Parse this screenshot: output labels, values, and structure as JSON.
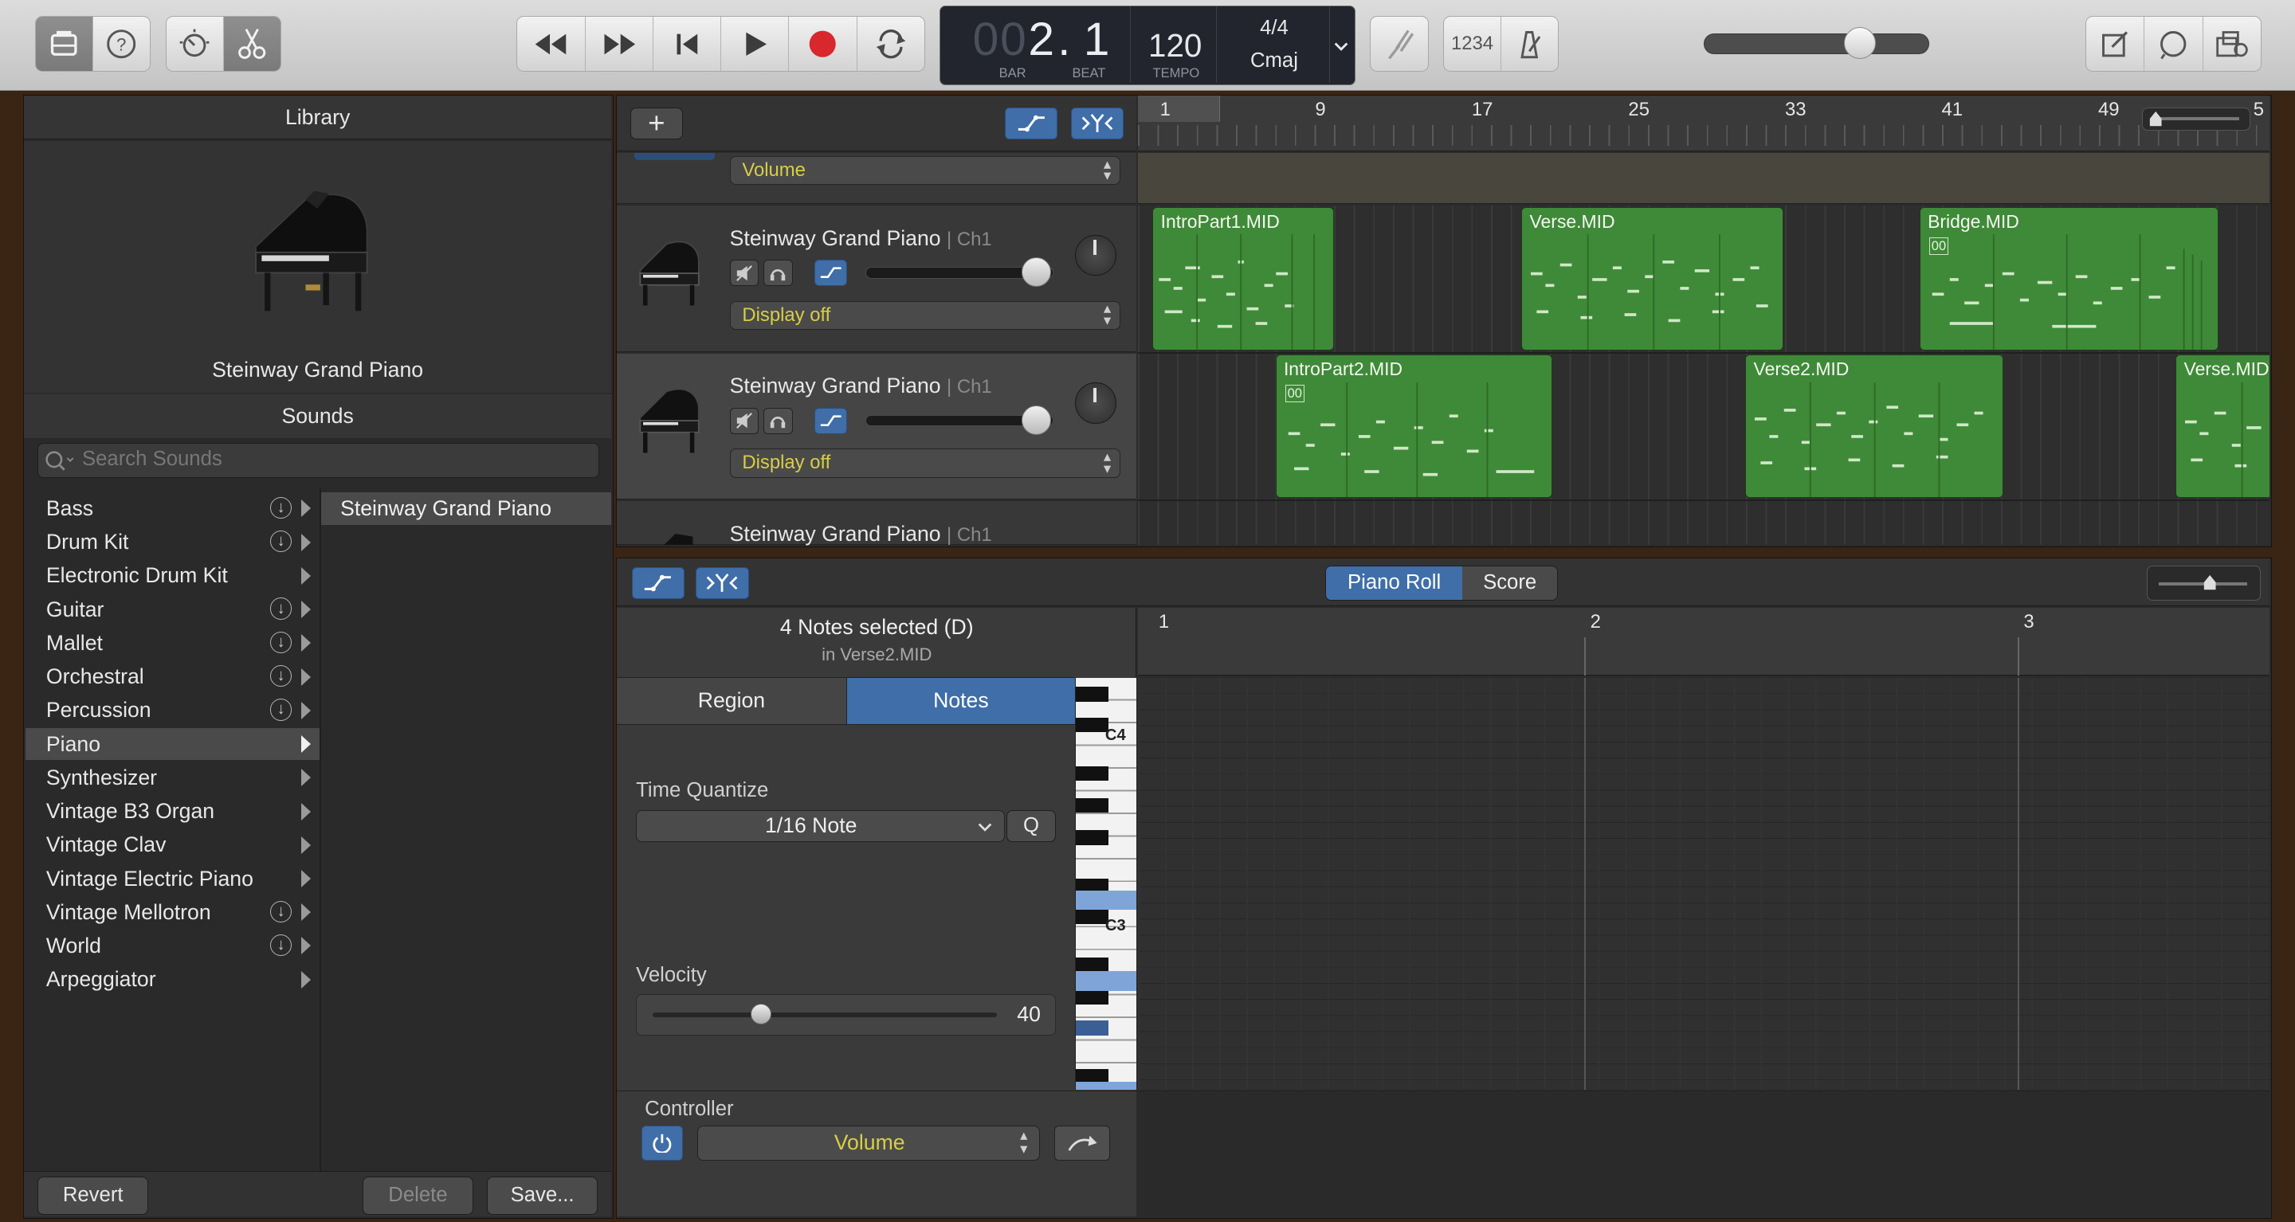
{
  "toolbar": {
    "lcd": {
      "bar_dim": "00",
      "bar": "2",
      "beat": ". 1",
      "bar_label": "BAR",
      "beat_label": "BEAT",
      "tempo": "120",
      "tempo_label": "TEMPO",
      "signature": "4/4",
      "key": "Cmaj"
    },
    "count_in_label": "1234",
    "master_volume": 0.69
  },
  "library": {
    "title": "Library",
    "patch_name": "Steinway Grand Piano",
    "sounds_header": "Sounds",
    "search_placeholder": "Search Sounds",
    "categories": [
      {
        "label": "Bass"
      },
      {
        "label": "Drum Kit"
      },
      {
        "label": "Electronic Drum Kit"
      },
      {
        "label": "Guitar"
      },
      {
        "label": "Mallet"
      },
      {
        "label": "Orchestral"
      },
      {
        "label": "Percussion"
      },
      {
        "label": "Piano"
      },
      {
        "label": "Synthesizer"
      },
      {
        "label": "Vintage B3 Organ"
      },
      {
        "label": "Vintage Clav"
      },
      {
        "label": "Vintage Electric Piano"
      },
      {
        "label": "Vintage Mellotron"
      },
      {
        "label": "World"
      },
      {
        "label": "Arpeggiator"
      }
    ],
    "selected_category": "Piano",
    "sub_items": [
      "Steinway Grand Piano"
    ],
    "revert_label": "Revert",
    "delete_label": "Delete",
    "save_label": "Save..."
  },
  "tracks": {
    "add_label": "+",
    "ruler": [
      "1",
      "9",
      "17",
      "25",
      "33",
      "41",
      "49",
      "5"
    ],
    "automation_param": "Volume",
    "rows": [
      {
        "name": "Steinway Grand Piano",
        "channel": "| Ch1",
        "display": "Display off"
      },
      {
        "name": "Steinway Grand Piano",
        "channel": "| Ch1",
        "display": "Display off"
      },
      {
        "name": "Steinway Grand Piano",
        "channel": "| Ch1"
      }
    ],
    "regions": [
      {
        "name": "IntroPart1.MID"
      },
      {
        "name": "Verse.MID"
      },
      {
        "name": "Bridge.MID",
        "badge": "00"
      },
      {
        "name": "IntroPart2.MID",
        "badge": "00"
      },
      {
        "name": "Verse2.MID"
      },
      {
        "name": "Verse.MID"
      }
    ]
  },
  "editor": {
    "tabs": [
      {
        "label": "Piano Roll"
      },
      {
        "label": "Score"
      }
    ],
    "selection_title": "4 Notes selected (D)",
    "selection_sub": "in Verse2.MID",
    "region_tab": "Region",
    "notes_tab": "Notes",
    "time_quantize_label": "Time Quantize",
    "time_quantize_value": "1/16 Note",
    "quantize_button": "Q",
    "velocity_label": "Velocity",
    "velocity_value": "40",
    "controller_label": "Controller",
    "controller_value": "Volume",
    "ruler": [
      "1",
      "2",
      "3"
    ],
    "key_labels": {
      "c4": "C4",
      "c3": "C3"
    }
  }
}
